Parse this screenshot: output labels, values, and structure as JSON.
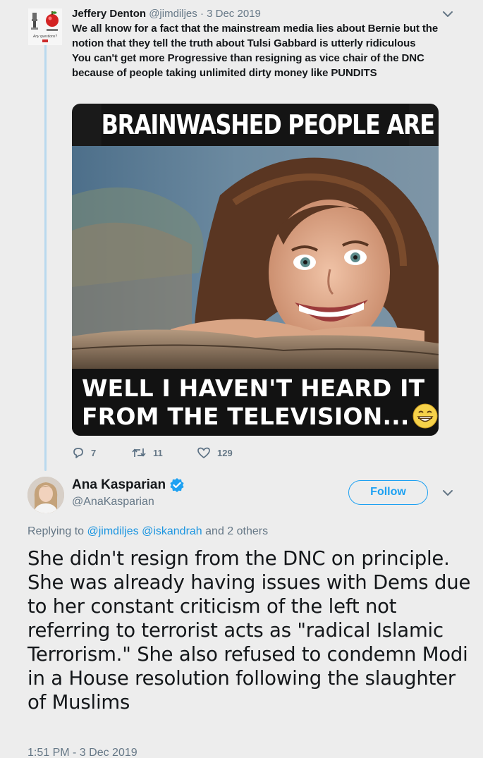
{
  "tweet1": {
    "author_name": "Jeffery Denton",
    "handle": "@jimdiljes",
    "separator": "·",
    "date": "3 Dec 2019",
    "text_lines": [
      "We all know for a fact that the mainstream media lies about Bernie but the notion that they tell the truth about Tulsi Gabbard is utterly ridiculous",
      "You can't get more Progressive than resigning as vice chair of the DNC because of people taking unlimited dirty money like PUNDITS"
    ],
    "avatar_caption": "Any questions?",
    "image": {
      "top_caption": "BRAINWASHED PEOPLE ARE LIKE",
      "bottom_caption_line1": "WELL I HAVEN'T HEARD IT",
      "bottom_caption_line2": "FROM THE TELEVISION..."
    },
    "actions": {
      "replies": "7",
      "retweets": "11",
      "likes": "129"
    }
  },
  "tweet2": {
    "author_name": "Ana Kasparian",
    "handle": "@AnaKasparian",
    "follow_label": "Follow",
    "replying_prefix": "Replying to",
    "replying_mentions": "@jimdiljes @iskandrah",
    "replying_suffix": "and 2 others",
    "text": "She didn't resign from the DNC on principle. She was already having issues with Dems due to her constant criticism of the left not referring to terrorist acts as \"radical Islamic Terrorism.\" She also refused to condemn Modi in a House resolution following the slaughter of Muslims",
    "timestamp": "1:51 PM - 3 Dec 2019"
  },
  "colors": {
    "accent": "#1da1f2",
    "muted": "#657786",
    "thread_line": "#b9d9ee",
    "verified": "#1da1f2"
  },
  "icons": {
    "reply": "speech-bubble-icon",
    "retweet": "retweet-arrows-icon",
    "like": "heart-icon",
    "verified": "verified-badge-icon",
    "more": "chevron-down-icon"
  }
}
